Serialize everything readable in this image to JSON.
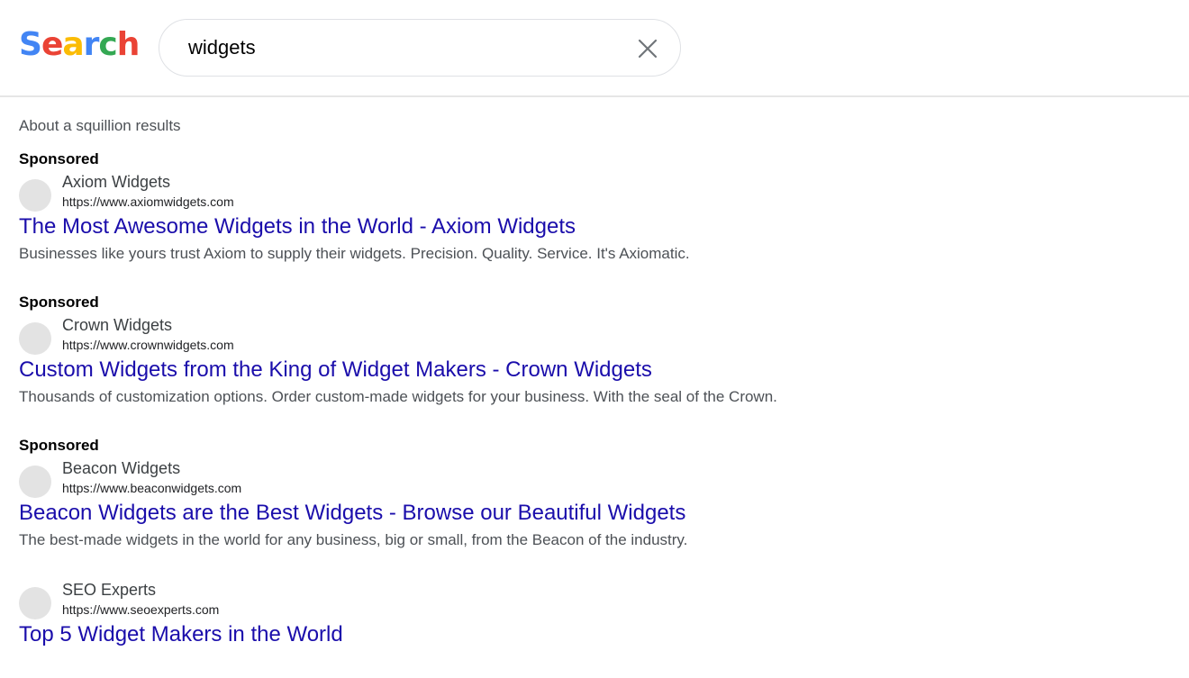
{
  "header": {
    "logo_letters": [
      {
        "char": "S",
        "color": "#4285f4"
      },
      {
        "char": "e",
        "color": "#ea4335"
      },
      {
        "char": "a",
        "color": "#fbbc05"
      },
      {
        "char": "r",
        "color": "#4285f4"
      },
      {
        "char": "c",
        "color": "#34a853"
      },
      {
        "char": "h",
        "color": "#ea4335"
      }
    ],
    "search": {
      "value": "widgets",
      "clear_icon": "close-icon"
    }
  },
  "results": {
    "stats": "About a squillion results",
    "items": [
      {
        "sponsored_label": "Sponsored",
        "site_name": "Axiom Widgets",
        "url": "https://www.axiomwidgets.com",
        "title": "The Most Awesome Widgets in the World - Axiom Widgets",
        "snippet": "Businesses like yours trust Axiom to supply their widgets. Precision. Quality. Service. It's Axiomatic."
      },
      {
        "sponsored_label": "Sponsored",
        "site_name": "Crown Widgets",
        "url": "https://www.crownwidgets.com",
        "title": "Custom Widgets from the King of Widget Makers - Crown Widgets",
        "snippet": "Thousands of customization options. Order custom-made widgets for your business. With the seal of the Crown."
      },
      {
        "sponsored_label": "Sponsored",
        "site_name": "Beacon Widgets",
        "url": "https://www.beaconwidgets.com",
        "title": "Beacon Widgets are the Best Widgets - Browse our Beautiful Widgets",
        "snippet": "The best-made widgets in the world for any business, big or small, from the Beacon of the industry."
      },
      {
        "sponsored_label": "",
        "site_name": "SEO Experts",
        "url": "https://www.seoexperts.com",
        "title": "Top 5 Widget Makers in the World",
        "snippet": ""
      }
    ]
  }
}
